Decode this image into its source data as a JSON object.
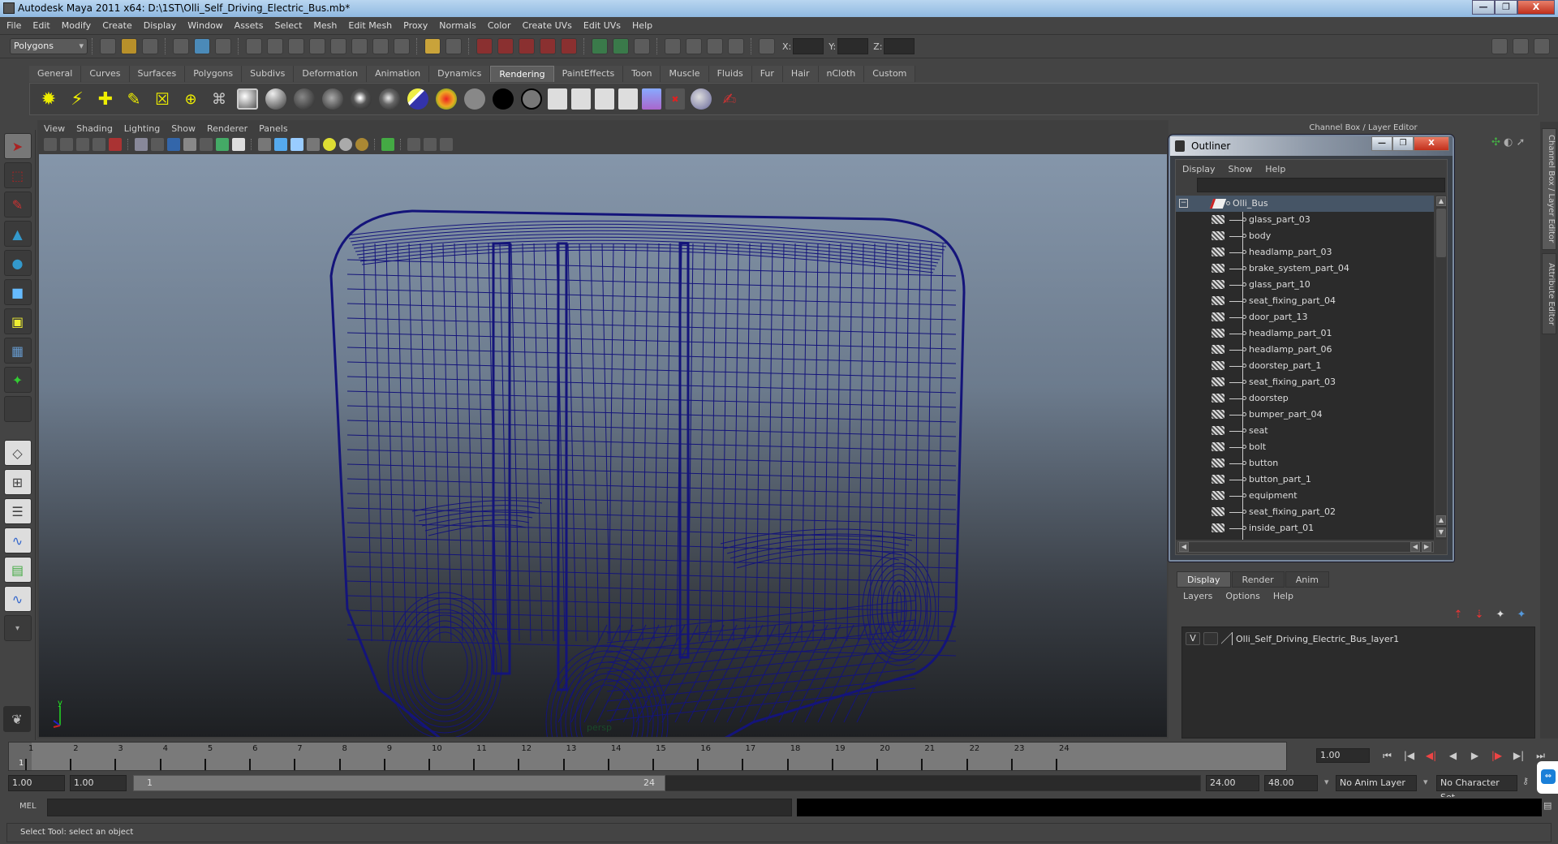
{
  "window": {
    "title": "Autodesk Maya 2011 x64: D:\\1ST\\Olli_Self_Driving_Electric_Bus.mb*",
    "minimize": "—",
    "restore": "❐",
    "close": "X"
  },
  "menubar": [
    "File",
    "Edit",
    "Modify",
    "Create",
    "Display",
    "Window",
    "Assets",
    "Select",
    "Mesh",
    "Edit Mesh",
    "Proxy",
    "Normals",
    "Color",
    "Create UVs",
    "Edit UVs",
    "Help"
  ],
  "statusline": {
    "menuset": "Polygons",
    "x_label": "X:",
    "y_label": "Y:",
    "z_label": "Z:",
    "x_value": "",
    "y_value": "",
    "z_value": ""
  },
  "shelf": {
    "tabs": [
      "General",
      "Curves",
      "Surfaces",
      "Polygons",
      "Subdivs",
      "Deformation",
      "Animation",
      "Dynamics",
      "Rendering",
      "PaintEffects",
      "Toon",
      "Muscle",
      "Fluids",
      "Fur",
      "Hair",
      "nCloth",
      "Custom"
    ],
    "active_tab": "Rendering",
    "icons": [
      "ambient-light-icon",
      "directional-light-icon",
      "point-light-icon",
      "spot-light-icon",
      "area-light-icon",
      "volume-light-icon",
      "camera-icon",
      "hypershade-icon",
      "blinn-material-icon",
      "lambert-material-icon",
      "phong-material-icon",
      "phong-e-material-icon",
      "anisotropic-material-icon",
      "ramp-shader-icon",
      "layered-shader-icon",
      "use-background-icon",
      "surface-shader-icon",
      "shading-map-icon",
      "render-view-icon",
      "render-current-frame-icon",
      "ipr-render-icon",
      "render-settings-icon",
      "hypershade-window-icon",
      "batch-render-icon",
      "cancel-batch-icon",
      "render-globals-icon",
      "paint-canvas-icon"
    ]
  },
  "viewport": {
    "menu": [
      "View",
      "Shading",
      "Lighting",
      "Show",
      "Renderer",
      "Panels"
    ],
    "camera_label": "persp",
    "axis_label": "y",
    "wireframe_color": "#14147a"
  },
  "toolbox": {
    "tools": [
      "select-tool-icon",
      "lasso-tool-icon",
      "paint-select-tool-icon",
      "move-tool-icon",
      "rotate-tool-icon",
      "scale-tool-icon",
      "universal-manipulator-icon",
      "soft-modification-icon",
      "show-manipulator-icon",
      "last-tool-icon"
    ],
    "layouts": [
      "single-perspective-layout-icon",
      "four-view-layout-icon",
      "outliner-persp-layout-icon",
      "persp-graph-layout-icon",
      "hypershade-persp-layout-icon",
      "persp-graph-hypergraph-layout-icon",
      "more-layouts-icon"
    ]
  },
  "outliner": {
    "title": "Outliner",
    "menu": [
      "Display",
      "Show",
      "Help"
    ],
    "filter": "",
    "root": "Olli_Bus",
    "items": [
      "glass_part_03",
      "body",
      "headlamp_part_03",
      "brake_system_part_04",
      "glass_part_10",
      "seat_fixing_part_04",
      "door_part_13",
      "headlamp_part_01",
      "headlamp_part_06",
      "doorstep_part_1",
      "seat_fixing_part_03",
      "doorstep",
      "bumper_part_04",
      "seat",
      "bolt",
      "button",
      "button_part_1",
      "equipment",
      "seat_fixing_part_02",
      "inside_part_01"
    ]
  },
  "channelbox": {
    "title": "Channel Box / Layer Editor",
    "side_tabs": [
      "Channel Box / Layer Editor",
      "Attribute Editor"
    ]
  },
  "layer_editor": {
    "tabs": [
      "Display",
      "Render",
      "Anim"
    ],
    "active_tab": "Display",
    "menu": [
      "Layers",
      "Options",
      "Help"
    ],
    "layers": [
      {
        "visible": "V",
        "name": "Olli_Self_Driving_Electric_Bus_layer1"
      }
    ]
  },
  "timeline": {
    "ticks": [
      "1",
      "2",
      "3",
      "4",
      "5",
      "6",
      "7",
      "8",
      "9",
      "10",
      "11",
      "12",
      "13",
      "14",
      "15",
      "16",
      "17",
      "18",
      "19",
      "20",
      "21",
      "22",
      "23",
      "24"
    ],
    "current_frame_label": "1",
    "current_time": "1.00"
  },
  "range": {
    "start_time": "1.00",
    "playback_start": "1.00",
    "range_start_label": "1",
    "range_end_label": "24",
    "playback_end": "24.00",
    "end_time": "48.00",
    "anim_layer": "No Anim Layer",
    "character_set": "No Character Set"
  },
  "playback_controls": [
    "⏮",
    "|◀",
    "◀|",
    "◀",
    "▶",
    "|▶",
    "▶|",
    "⏭"
  ],
  "mel": {
    "label": "MEL",
    "command": ""
  },
  "help_line": "Select Tool: select an object"
}
